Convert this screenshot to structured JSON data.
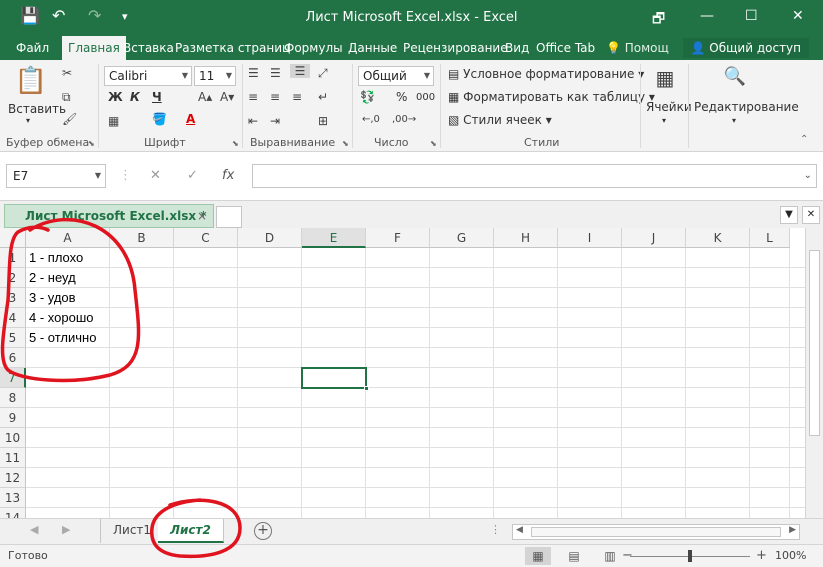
{
  "window": {
    "title": "Лист Microsoft Excel.xlsx - Excel",
    "controls": {
      "restore": "🗗",
      "minimize": "—",
      "maximize": "☐",
      "close": "✕"
    }
  },
  "quick_access": {
    "save": "💾",
    "undo": "↶",
    "redo": "↷",
    "customize": "▾"
  },
  "ribbon_tabs": [
    {
      "label": "Файл"
    },
    {
      "label": "Главная"
    },
    {
      "label": "Вставка"
    },
    {
      "label": "Разметка страниц"
    },
    {
      "label": "Формулы"
    },
    {
      "label": "Данные"
    },
    {
      "label": "Рецензирование"
    },
    {
      "label": "Вид"
    },
    {
      "label": "Office Tab"
    },
    {
      "label": "Помощ"
    }
  ],
  "share_label": "Общий доступ",
  "ribbon": {
    "clipboard": {
      "paste_label": "Вставить",
      "group": "Буфер обмена"
    },
    "font": {
      "name": "Calibri",
      "size": "11",
      "bold": "Ж",
      "italic": "К",
      "underline": "Ч",
      "group": "Шрифт"
    },
    "alignment": {
      "group": "Выравнивание"
    },
    "number": {
      "format": "Общий",
      "group": "Число",
      "percent": "%",
      "thousands": "000"
    },
    "styles": {
      "conditional": "Условное форматирование",
      "as_table": "Форматировать как таблицу",
      "cell_styles": "Стили ячеек",
      "group": "Стили"
    },
    "cells": {
      "label": "Ячейки"
    },
    "editing": {
      "label": "Редактирование"
    }
  },
  "formula_bar": {
    "name_box": "E7",
    "cancel": "✕",
    "enter": "✓",
    "fx": "fx",
    "value": ""
  },
  "document_tab": {
    "label": "Лист Microsoft Excel.xlsx *",
    "close": "×"
  },
  "grid": {
    "columns": [
      "A",
      "B",
      "C",
      "D",
      "E",
      "F",
      "G",
      "H",
      "I",
      "J",
      "K",
      "L"
    ],
    "rows": [
      "1",
      "2",
      "3",
      "4",
      "5",
      "6",
      "7",
      "8",
      "9",
      "10",
      "11",
      "12",
      "13",
      "14"
    ],
    "selected_cell": "E7",
    "cells_A": [
      "1 - плохо",
      "2 - неуд",
      "3 - удов",
      "4 - хорошо",
      "5 - отлично"
    ]
  },
  "sheets": [
    {
      "label": "Лист1"
    },
    {
      "label": "Лист2"
    }
  ],
  "active_sheet": "Лист2",
  "status": {
    "ready": "Готово",
    "zoom": "100%",
    "zoom_minus": "−",
    "zoom_plus": "+"
  },
  "colors": {
    "excel_green": "#217346",
    "annotation_red": "#e0141e"
  }
}
